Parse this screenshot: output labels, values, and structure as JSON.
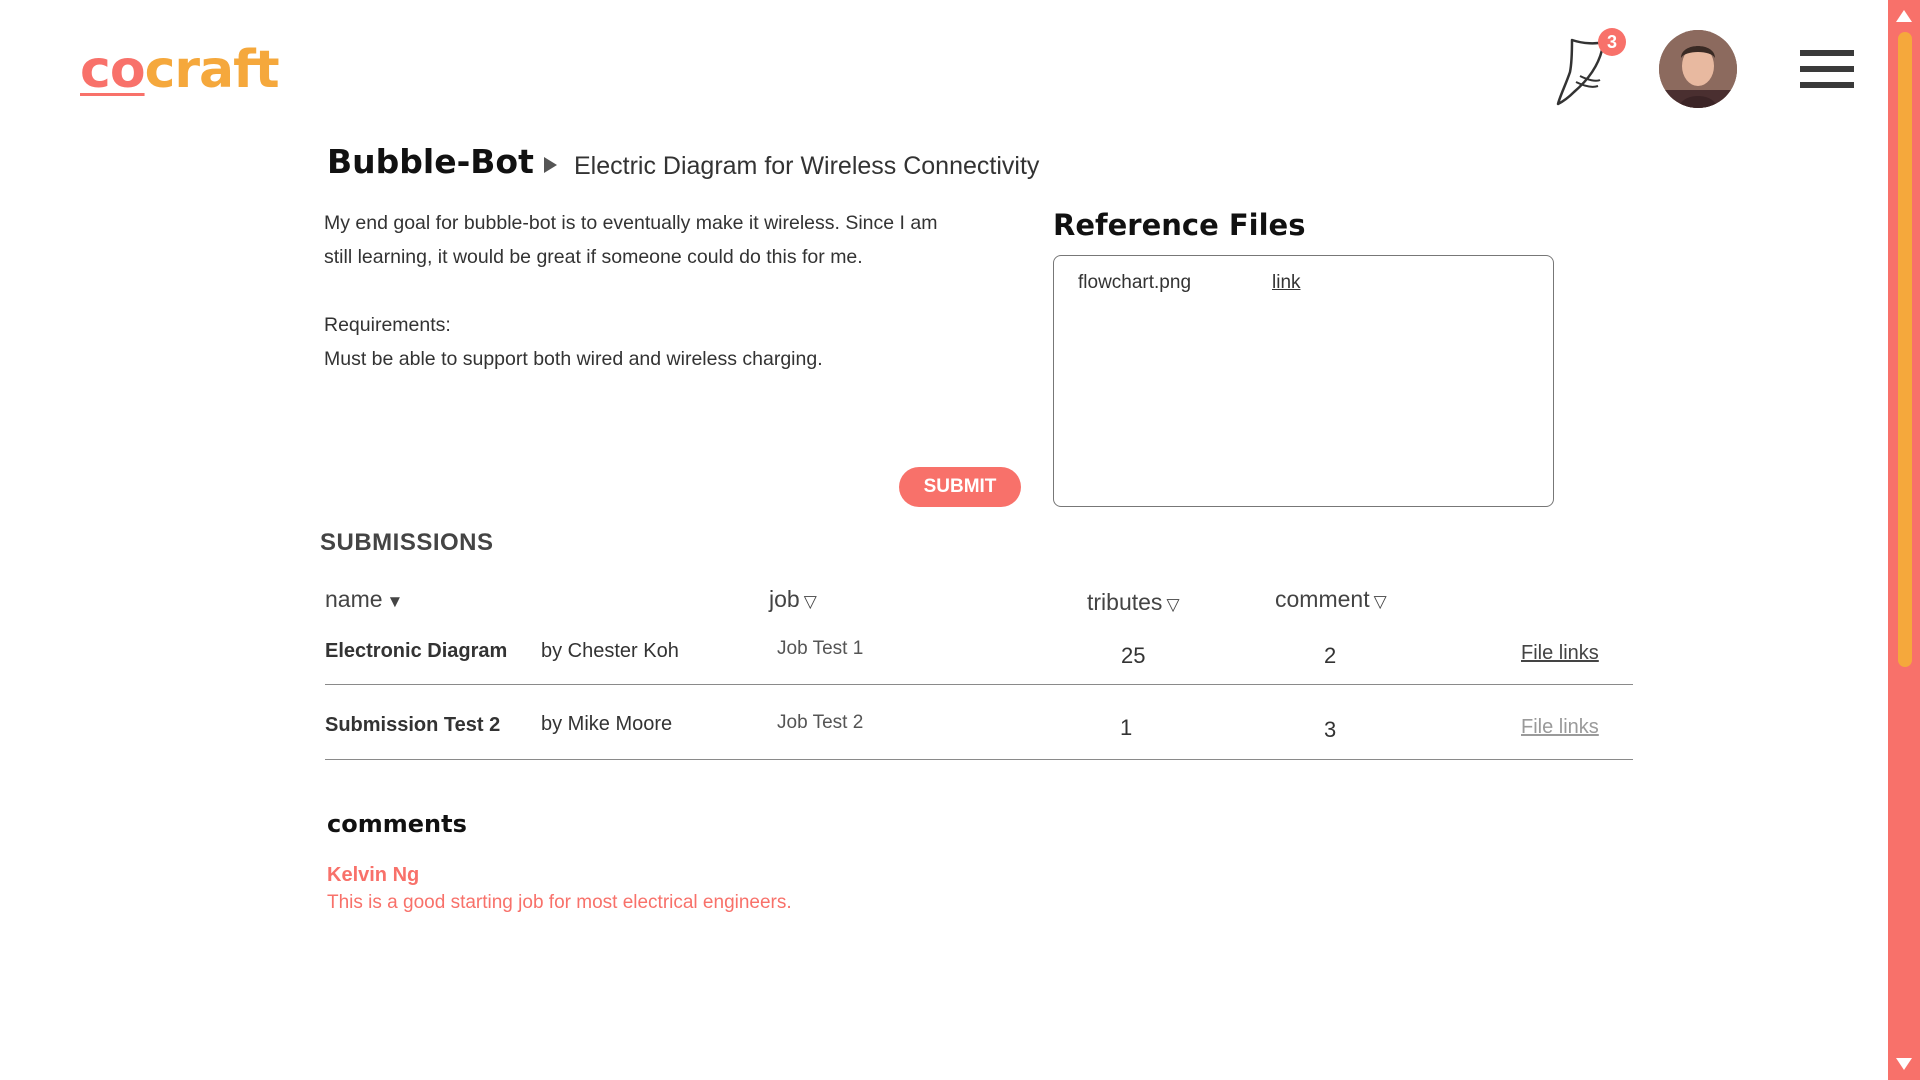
{
  "header": {
    "logo": {
      "part1": "co",
      "part2": "craft"
    },
    "notifications": {
      "count": "3",
      "icon": "horn-icon"
    },
    "avatar": {
      "icon": "user-avatar"
    },
    "menu": {
      "icon": "hamburger-menu-icon"
    }
  },
  "project": {
    "title": "Bubble-Bot",
    "subtitle": "Electric Diagram for Wireless Connectivity",
    "description_lines": [
      "My end goal for bubble-bot is to eventually make it wireless. Since I am",
      "still learning, it would be great if someone could do this for me.",
      "",
      "Requirements:",
      "Must be able to support both wired and wireless charging."
    ],
    "submit_label": "SUBMIT"
  },
  "reference_files": {
    "title": "Reference Files",
    "files": [
      {
        "name": "flowchart.png",
        "link_label": "link"
      }
    ]
  },
  "submissions": {
    "title": "SUBMISSIONS",
    "columns": {
      "name": {
        "label": "name",
        "sort_icon": "▼"
      },
      "job": {
        "label": "job",
        "sort_icon": "▽"
      },
      "tributes": {
        "label": "tributes",
        "sort_icon": "▽"
      },
      "comment": {
        "label": "comment",
        "sort_icon": "▽"
      }
    },
    "rows": [
      {
        "name": "Electronic Diagram",
        "author": "by Chester Koh",
        "job": "Job Test 1",
        "tributes": "25",
        "comments": "2",
        "file_links": "File links"
      },
      {
        "name": "Submission Test 2",
        "author": "by Mike Moore",
        "job": "Job Test 2",
        "tributes": "1",
        "comments": "3",
        "file_links": "File links"
      }
    ]
  },
  "comments": {
    "title": "comments",
    "items": [
      {
        "author": "Kelvin Ng",
        "text": "This is a good starting job for most electrical engineers."
      }
    ]
  },
  "colors": {
    "accent": "#f8716a",
    "secondary": "#f5a83c"
  }
}
